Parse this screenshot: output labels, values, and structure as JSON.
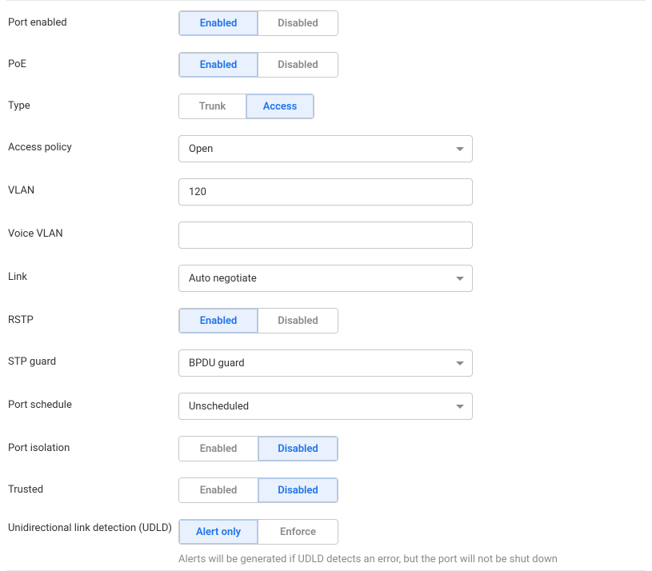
{
  "labels": {
    "port_enabled": "Port enabled",
    "poe": "PoE",
    "type": "Type",
    "access_policy": "Access policy",
    "vlan": "VLAN",
    "voice_vlan": "Voice VLAN",
    "link": "Link",
    "rstp": "RSTP",
    "stp_guard": "STP guard",
    "port_schedule": "Port schedule",
    "port_isolation": "Port isolation",
    "trusted": "Trusted",
    "udld": "Unidirectional link detection (UDLD)"
  },
  "toggles": {
    "port_enabled": {
      "options": [
        "Enabled",
        "Disabled"
      ],
      "active": 0
    },
    "poe": {
      "options": [
        "Enabled",
        "Disabled"
      ],
      "active": 0
    },
    "type": {
      "options": [
        "Trunk",
        "Access"
      ],
      "active": 1
    },
    "rstp": {
      "options": [
        "Enabled",
        "Disabled"
      ],
      "active": 0
    },
    "port_isolation": {
      "options": [
        "Enabled",
        "Disabled"
      ],
      "active": 1
    },
    "trusted": {
      "options": [
        "Enabled",
        "Disabled"
      ],
      "active": 1
    },
    "udld": {
      "options": [
        "Alert only",
        "Enforce"
      ],
      "active": 0
    }
  },
  "selects": {
    "access_policy": "Open",
    "link": "Auto negotiate",
    "stp_guard": "BPDU guard",
    "port_schedule": "Unscheduled"
  },
  "inputs": {
    "vlan": "120",
    "voice_vlan": ""
  },
  "hints": {
    "udld": "Alerts will be generated if UDLD detects an error, but the port will not be shut down"
  }
}
